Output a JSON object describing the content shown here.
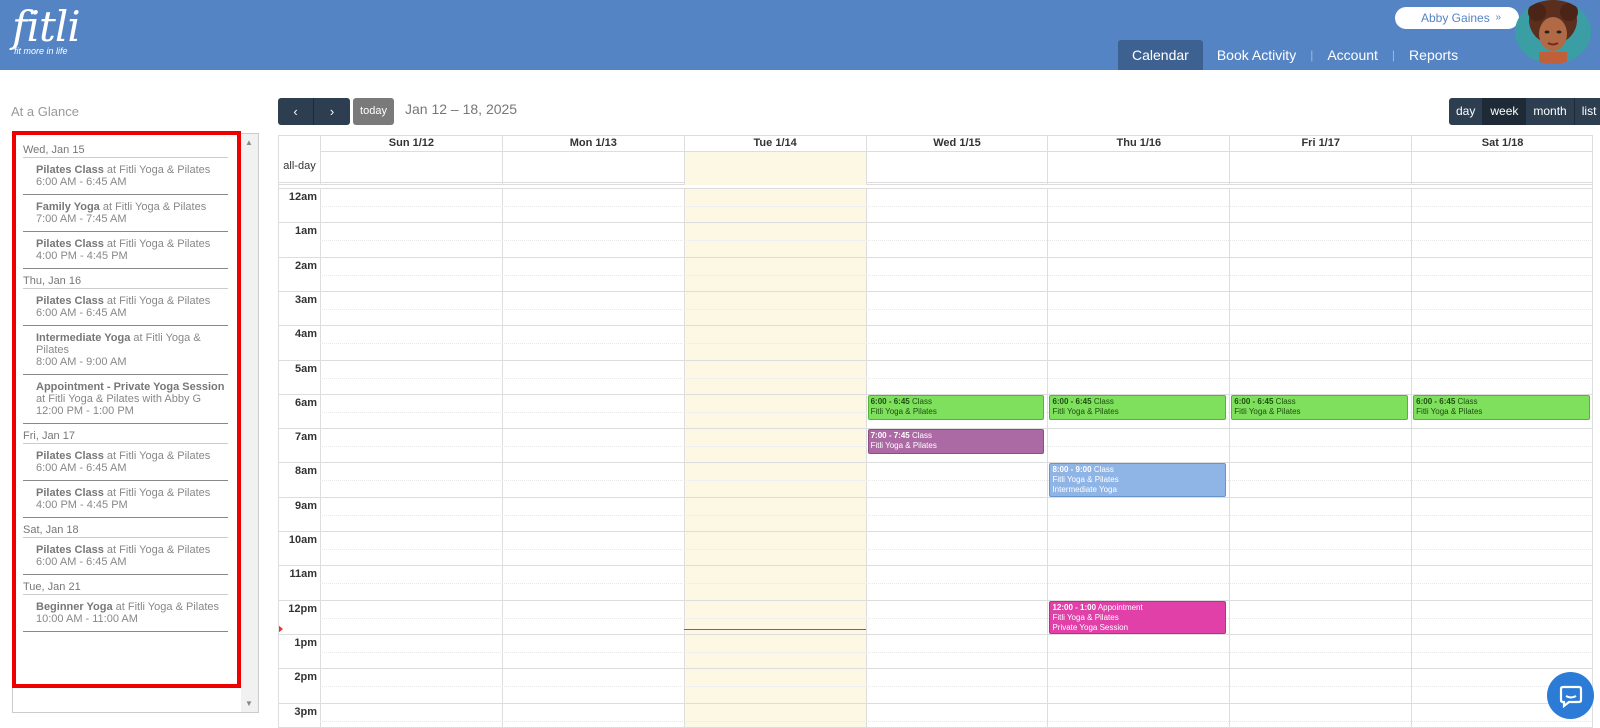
{
  "brand": {
    "logo": "fitli",
    "tagline": "fit more in life"
  },
  "user": {
    "name": "Abby Gaines",
    "chevron": "»"
  },
  "nav": [
    {
      "label": "Calendar",
      "active": true
    },
    {
      "label": "Book Activity",
      "active": false
    },
    {
      "label": "Account",
      "active": false
    },
    {
      "label": "Reports",
      "active": false
    }
  ],
  "sidebar": {
    "title": "At a Glance",
    "days": [
      {
        "label": "Wed, Jan 15",
        "events": [
          {
            "name": "Pilates Class",
            "where": " at Fitli Yoga & Pilates",
            "time": "6:00 AM - 6:45 AM"
          },
          {
            "name": "Family Yoga",
            "where": " at Fitli Yoga & Pilates",
            "time": "7:00 AM - 7:45 AM"
          },
          {
            "name": "Pilates Class",
            "where": " at Fitli Yoga & Pilates",
            "time": "4:00 PM - 4:45 PM"
          }
        ]
      },
      {
        "label": "Thu, Jan 16",
        "events": [
          {
            "name": "Pilates Class",
            "where": " at Fitli Yoga & Pilates",
            "time": "6:00 AM - 6:45 AM"
          },
          {
            "name": "Intermediate Yoga",
            "where": " at Fitli Yoga & Pilates",
            "time": "8:00 AM - 9:00 AM"
          },
          {
            "name": "Appointment - Private Yoga Session",
            "where": " at Fitli Yoga & Pilates with Abby G",
            "time": "12:00 PM - 1:00 PM"
          }
        ]
      },
      {
        "label": "Fri, Jan 17",
        "events": [
          {
            "name": "Pilates Class",
            "where": " at Fitli Yoga & Pilates",
            "time": "6:00 AM - 6:45 AM"
          },
          {
            "name": "Pilates Class",
            "where": " at Fitli Yoga & Pilates",
            "time": "4:00 PM - 4:45 PM"
          }
        ]
      },
      {
        "label": "Sat, Jan 18",
        "events": [
          {
            "name": "Pilates Class",
            "where": " at Fitli Yoga & Pilates",
            "time": "6:00 AM - 6:45 AM"
          }
        ]
      },
      {
        "label": "Tue, Jan 21",
        "events": [
          {
            "name": "Beginner Yoga",
            "where": " at Fitli Yoga & Pilates",
            "time": "10:00 AM - 11:00 AM"
          }
        ]
      }
    ]
  },
  "toolbar": {
    "prev": "‹",
    "next": "›",
    "today": "today",
    "range": "Jan 12 – 18, 2025",
    "views": [
      {
        "label": "day",
        "active": false
      },
      {
        "label": "week",
        "active": true
      },
      {
        "label": "month",
        "active": false
      },
      {
        "label": "list",
        "active": false
      }
    ]
  },
  "calendar": {
    "columns": [
      "Sun 1/12",
      "Mon 1/13",
      "Tue 1/14",
      "Wed 1/15",
      "Thu 1/16",
      "Fri 1/17",
      "Sat 1/18"
    ],
    "today_index": 2,
    "allday_label": "all-day",
    "hours": [
      "12am",
      "1am",
      "2am",
      "3am",
      "4am",
      "5am",
      "6am",
      "7am",
      "8am",
      "9am",
      "10am",
      "11am",
      "12pm",
      "1pm",
      "2pm",
      "3pm"
    ],
    "now_hour": 12.85,
    "events": [
      {
        "day": 3,
        "start": 6,
        "end": 6.75,
        "time": "6:00 - 6:45",
        "kind": "Class",
        "lines": [
          "Fitli Yoga & Pilates"
        ],
        "color": "green"
      },
      {
        "day": 4,
        "start": 6,
        "end": 6.75,
        "time": "6:00 - 6:45",
        "kind": "Class",
        "lines": [
          "Fitli Yoga & Pilates"
        ],
        "color": "green"
      },
      {
        "day": 5,
        "start": 6,
        "end": 6.75,
        "time": "6:00 - 6:45",
        "kind": "Class",
        "lines": [
          "Fitli Yoga & Pilates"
        ],
        "color": "green"
      },
      {
        "day": 6,
        "start": 6,
        "end": 6.75,
        "time": "6:00 - 6:45",
        "kind": "Class",
        "lines": [
          "Fitli Yoga & Pilates"
        ],
        "color": "green"
      },
      {
        "day": 3,
        "start": 7,
        "end": 7.75,
        "time": "7:00 - 7:45",
        "kind": "Class",
        "lines": [
          "Fitli Yoga & Pilates"
        ],
        "color": "purple"
      },
      {
        "day": 4,
        "start": 8,
        "end": 9,
        "time": "8:00 - 9:00",
        "kind": "Class",
        "lines": [
          "Fitli Yoga & Pilates",
          "Intermediate Yoga"
        ],
        "color": "blue"
      },
      {
        "day": 4,
        "start": 12,
        "end": 13,
        "time": "12:00 - 1:00",
        "kind": "Appointment",
        "lines": [
          "Fitli Yoga & Pilates",
          "Private Yoga Session"
        ],
        "color": "pink"
      }
    ]
  },
  "colors": {
    "header": "#5584c4",
    "today_bg": "#fcf8e3",
    "now_line": "#e33333"
  }
}
